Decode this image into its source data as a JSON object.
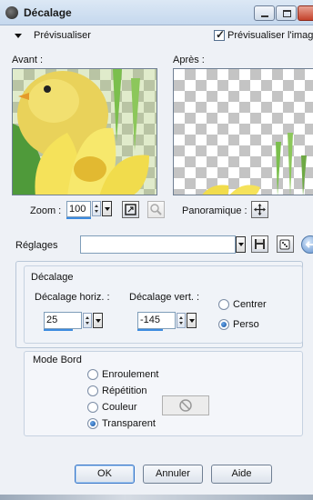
{
  "window": {
    "title": "Décalage",
    "icon": "app-icon"
  },
  "preview": {
    "toggle_label": "Prévisualiser",
    "preview_image_label": "Prévisualiser l'image",
    "preview_image_checked": true,
    "before_label": "Avant :",
    "after_label": "Après :"
  },
  "zoom": {
    "label": "Zoom :",
    "value": "100"
  },
  "pan": {
    "label": "Panoramique :"
  },
  "settings": {
    "label": "Réglages",
    "value": ""
  },
  "offset": {
    "group_label": "Décalage",
    "horiz_label": "Décalage horiz. :",
    "horiz_value": "25",
    "vert_label": "Décalage vert. :",
    "vert_value": "-145",
    "center_label": "Centrer",
    "custom_label": "Perso",
    "selected": "Perso"
  },
  "edge_mode": {
    "group_label": "Mode Bord",
    "options": [
      "Enroulement",
      "Répétition",
      "Couleur",
      "Transparent"
    ],
    "selected": "Transparent"
  },
  "buttons": {
    "ok": "OK",
    "cancel": "Annuler",
    "help": "Aide"
  },
  "colors": {
    "accent": "#3c8be0",
    "title_bar": "#c5d8ee"
  }
}
